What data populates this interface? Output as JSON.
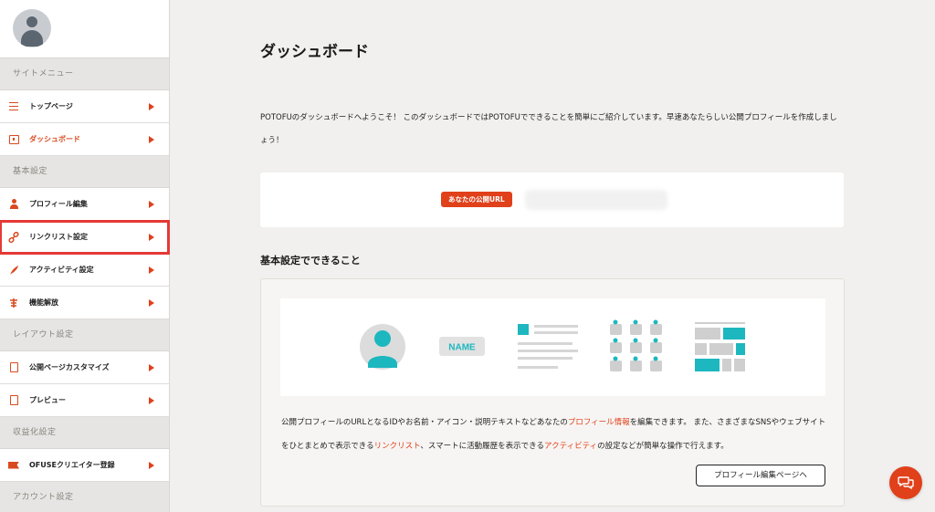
{
  "sidebar": {
    "sections": {
      "site_menu": "サイトメニュー",
      "basic": "基本設定",
      "layout": "レイアウト設定",
      "monetize": "収益化設定",
      "account": "アカウント設定"
    },
    "items": {
      "top": "トップページ",
      "dashboard": "ダッシュボード",
      "profile_edit": "プロフィール編集",
      "link_list": "リンクリスト設定",
      "activity": "アクティビティ設定",
      "unlock": "機能解放",
      "customize": "公開ページカスタマイズ",
      "preview": "プレビュー",
      "ofuse": "OFUSEクリエイター登録"
    }
  },
  "main": {
    "title": "ダッシュボード",
    "intro": "POTOFUのダッシュボードへようこそ！ このダッシュボードではPOTOFUでできることを簡単にご紹介しています。早速あなたらしい公開プロフィールを作成しましょう！",
    "url_badge": "あなたの公開URL",
    "section_title": "基本設定でできること",
    "illus_name": "NAME",
    "desc": {
      "p1": "公開プロフィールのURLとなるIDやお名前・アイコン・説明テキストなどあなたの",
      "hl1": "プロフィール情報",
      "p2": "を編集できます。 また、さまざまなSNSやウェブサイトをひとまとめで表示できる",
      "hl2": "リンクリスト",
      "p3": "、スマートに活動履歴を表示できる",
      "hl3": "アクティビティ",
      "p4": "の設定などが簡単な操作で行えます。"
    },
    "edit_button": "プロフィール編集ページへ"
  },
  "colors": {
    "accent": "#e0401a",
    "teal": "#1db7bf",
    "highlight_border": "#e53935"
  }
}
